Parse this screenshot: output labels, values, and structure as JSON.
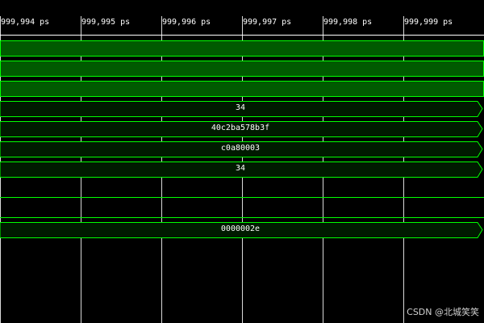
{
  "timeline": {
    "ticks": [
      "999,994 ps",
      "999,995 ps",
      "999,996 ps",
      "999,997 ps",
      "999,998 ps",
      "999,999 ps"
    ]
  },
  "signals": [
    {
      "type": "bit",
      "value": "1"
    },
    {
      "type": "bit",
      "value": "1"
    },
    {
      "type": "bit",
      "value": "1"
    },
    {
      "type": "bus",
      "value": "34"
    },
    {
      "type": "bus",
      "value": "40c2ba578b3f"
    },
    {
      "type": "bus",
      "value": "c0a80003"
    },
    {
      "type": "bus",
      "value": "34"
    },
    {
      "type": "low",
      "value": "0"
    },
    {
      "type": "low",
      "value": "0"
    },
    {
      "type": "bus",
      "value": "0000002e"
    }
  ],
  "watermark": "CSDN @北城笑笑",
  "colors": {
    "background": "#000000",
    "grid": "#ffffff",
    "waveform": "#00ff00",
    "bit_fill": "#005a00",
    "bus_fill": "#001a00",
    "text": "#ffffff"
  }
}
